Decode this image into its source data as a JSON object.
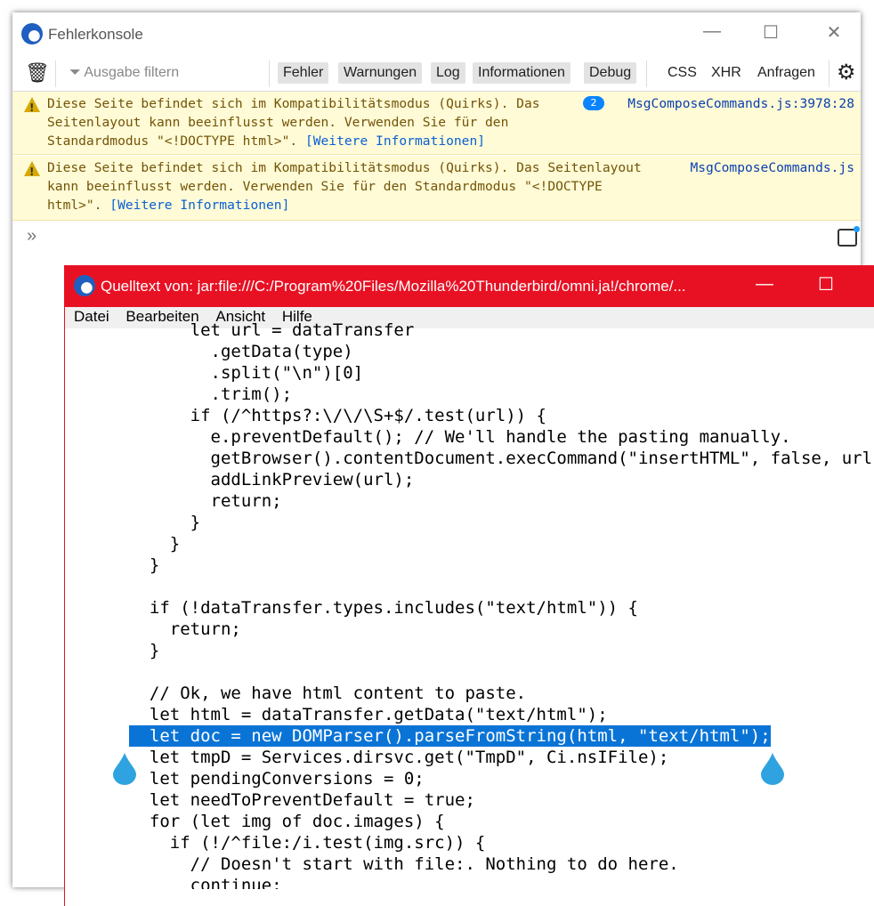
{
  "console": {
    "title": "Fehlerkonsole",
    "filter_placeholder": "Ausgabe filtern",
    "filters": [
      "Fehler",
      "Warnungen",
      "Log",
      "Informationen",
      "Debug"
    ],
    "extra_filters": [
      "CSS",
      "XHR",
      "Anfragen"
    ],
    "messages": [
      {
        "text": "Diese Seite befindet sich im Kompatibilitätsmodus (Quirks). Das\nSeitenlayout kann beeinflusst werden. Verwenden Sie für den\nStandardmodus \"<!DOCTYPE html>\". ",
        "link": "[Weitere Informationen]",
        "count": "2",
        "source": "MsgComposeCommands.js:3978:28"
      },
      {
        "text": "Diese Seite befindet sich im Kompatibilitätsmodus (Quirks). Das Seitenlayout\nkann beeinflusst werden. Verwenden Sie für den Standardmodus \"<!DOCTYPE\nhtml>\". ",
        "link": "[Weitere Informationen]",
        "source": "MsgComposeCommands.js"
      }
    ],
    "prompt": "»"
  },
  "source_window": {
    "title": "Quelltext von: jar:file:///C:/Program%20Files/Mozilla%20Thunderbird/omni.ja!/chrome/...",
    "menu": [
      "Datei",
      "Bearbeiten",
      "Ansicht",
      "Hilfe"
    ],
    "selection_color": "#0a74d6",
    "highlighted_line": 19,
    "code_lines": [
      "      let url = dataTransfer",
      "        .getData(type)",
      "        .split(\"\\n\")[0]",
      "        .trim();",
      "      if (/^https?:\\/\\/\\S+$/.test(url)) {",
      "        e.preventDefault(); // We'll handle the pasting manually.",
      "        getBrowser().contentDocument.execCommand(\"insertHTML\", false, url);",
      "        addLinkPreview(url);",
      "        return;",
      "      }",
      "    }",
      "  }",
      "",
      "  if (!dataTransfer.types.includes(\"text/html\")) {",
      "    return;",
      "  }",
      "",
      "  // Ok, we have html content to paste.",
      "  let html = dataTransfer.getData(\"text/html\");",
      "  let doc = new DOMParser().parseFromString(html, \"text/html\");",
      "  let tmpD = Services.dirsvc.get(\"TmpD\", Ci.nsIFile);",
      "  let pendingConversions = 0;",
      "  let needToPreventDefault = true;",
      "  for (let img of doc.images) {",
      "    if (!/^file:/i.test(img.src)) {",
      "      // Doesn't start with file:. Nothing to do here.",
      "      continue;"
    ]
  }
}
